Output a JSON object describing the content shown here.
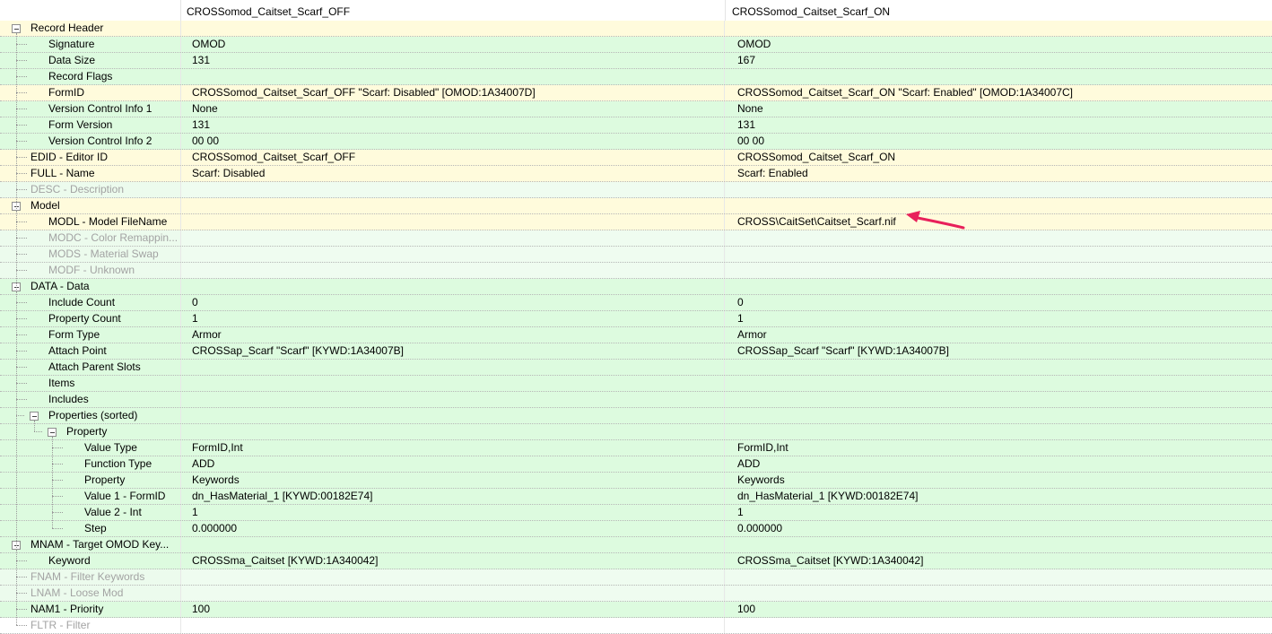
{
  "header": {
    "col1": "CROSSomod_Caitset_Scarf_OFF",
    "col2": "CROSSomod_Caitset_Scarf_ON"
  },
  "colors": {
    "header_row": "#fffbdc",
    "value_row": "#ddfbdf",
    "empty_row": "#ecfbed",
    "disabled_text": "#a3a3a3",
    "arrow": "#e8205a"
  },
  "rows": [
    {
      "label": "Record Header",
      "level": 0,
      "expander": true,
      "bg": "yellow",
      "v1": "",
      "v2": ""
    },
    {
      "label": "Signature",
      "level": 1,
      "bg": "green",
      "v1": "OMOD",
      "v2": "OMOD"
    },
    {
      "label": "Data Size",
      "level": 1,
      "bg": "green",
      "v1": "131",
      "v2": "167"
    },
    {
      "label": "Record Flags",
      "level": 1,
      "bg": "green",
      "v1": "",
      "v2": ""
    },
    {
      "label": "FormID",
      "level": 1,
      "bg": "yellow",
      "v1": "CROSSomod_Caitset_Scarf_OFF \"Scarf: Disabled\" [OMOD:1A34007D]",
      "v2": "CROSSomod_Caitset_Scarf_ON \"Scarf: Enabled\" [OMOD:1A34007C]"
    },
    {
      "label": "Version Control Info 1",
      "level": 1,
      "bg": "green",
      "v1": "None",
      "v2": "None"
    },
    {
      "label": "Form Version",
      "level": 1,
      "bg": "green",
      "v1": "131",
      "v2": "131"
    },
    {
      "label": "Version Control Info 2",
      "level": 1,
      "bg": "green",
      "v1": "00 00",
      "v2": "00 00"
    },
    {
      "label": "EDID - Editor ID",
      "level": 0,
      "bg": "yellow",
      "v1": "CROSSomod_Caitset_Scarf_OFF",
      "v2": "CROSSomod_Caitset_Scarf_ON"
    },
    {
      "label": "FULL - Name",
      "level": 0,
      "bg": "yellow",
      "v1": "Scarf: Disabled",
      "v2": "Scarf: Enabled"
    },
    {
      "label": "DESC - Description",
      "level": 0,
      "bg": "greenlight",
      "grey": true,
      "v1": "",
      "v2": ""
    },
    {
      "label": "Model",
      "level": 0,
      "expander": true,
      "bg": "yellow",
      "v1": "",
      "v2": ""
    },
    {
      "label": "MODL - Model FileName",
      "level": 1,
      "bg": "yellow",
      "v1": "",
      "v2": "CROSS\\CaitSet\\Caitset_Scarf.nif"
    },
    {
      "label": "MODC - Color Remappin...",
      "level": 1,
      "bg": "greenlight",
      "grey": true,
      "v1": "",
      "v2": ""
    },
    {
      "label": "MODS - Material Swap",
      "level": 1,
      "bg": "greenlight",
      "grey": true,
      "v1": "",
      "v2": ""
    },
    {
      "label": "MODF - Unknown",
      "level": 1,
      "bg": "greenlight",
      "grey": true,
      "v1": "",
      "v2": ""
    },
    {
      "label": "DATA - Data",
      "level": 0,
      "expander": true,
      "bg": "green",
      "v1": "",
      "v2": ""
    },
    {
      "label": "Include Count",
      "level": 1,
      "bg": "green",
      "v1": "0",
      "v2": "0"
    },
    {
      "label": "Property Count",
      "level": 1,
      "bg": "green",
      "v1": "1",
      "v2": "1"
    },
    {
      "label": "Form Type",
      "level": 1,
      "bg": "green",
      "v1": "Armor",
      "v2": "Armor"
    },
    {
      "label": "Attach Point",
      "level": 1,
      "bg": "green",
      "v1": "CROSSap_Scarf \"Scarf\" [KYWD:1A34007B]",
      "v2": "CROSSap_Scarf \"Scarf\" [KYWD:1A34007B]"
    },
    {
      "label": "Attach Parent Slots",
      "level": 1,
      "bg": "green",
      "v1": "",
      "v2": ""
    },
    {
      "label": "Items",
      "level": 1,
      "bg": "green",
      "v1": "",
      "v2": ""
    },
    {
      "label": "Includes",
      "level": 1,
      "bg": "green",
      "v1": "",
      "v2": ""
    },
    {
      "label": "Properties (sorted)",
      "level": 1,
      "expander": true,
      "bg": "green",
      "v1": "",
      "v2": ""
    },
    {
      "label": "Property",
      "level": 2,
      "expander": true,
      "bg": "green",
      "v1": "",
      "v2": ""
    },
    {
      "label": "Value Type",
      "level": 3,
      "bg": "green",
      "v1": "FormID,Int",
      "v2": "FormID,Int"
    },
    {
      "label": "Function Type",
      "level": 3,
      "bg": "green",
      "v1": "ADD",
      "v2": "ADD"
    },
    {
      "label": "Property",
      "level": 3,
      "bg": "green",
      "v1": "Keywords",
      "v2": "Keywords"
    },
    {
      "label": "Value 1 - FormID",
      "level": 3,
      "bg": "green",
      "v1": "dn_HasMaterial_1 [KYWD:00182E74]",
      "v2": "dn_HasMaterial_1 [KYWD:00182E74]"
    },
    {
      "label": "Value 2 - Int",
      "level": 3,
      "bg": "green",
      "v1": "1",
      "v2": "1"
    },
    {
      "label": "Step",
      "level": 3,
      "bg": "green",
      "v1": "0.000000",
      "v2": "0.000000"
    },
    {
      "label": "MNAM - Target OMOD Key...",
      "level": 0,
      "expander": true,
      "bg": "green",
      "v1": "",
      "v2": ""
    },
    {
      "label": "Keyword",
      "level": 1,
      "bg": "green",
      "v1": "CROSSma_Caitset [KYWD:1A340042]",
      "v2": "CROSSma_Caitset [KYWD:1A340042]"
    },
    {
      "label": "FNAM - Filter Keywords",
      "level": 0,
      "bg": "greenlight",
      "grey": true,
      "v1": "",
      "v2": ""
    },
    {
      "label": "LNAM - Loose Mod",
      "level": 0,
      "bg": "greenlight",
      "grey": true,
      "v1": "",
      "v2": ""
    },
    {
      "label": "NAM1 - Priority",
      "level": 0,
      "bg": "green",
      "v1": "100",
      "v2": "100"
    },
    {
      "label": "FLTR - Filter",
      "level": 0,
      "bg": "white",
      "grey": true,
      "v1": "",
      "v2": ""
    }
  ]
}
